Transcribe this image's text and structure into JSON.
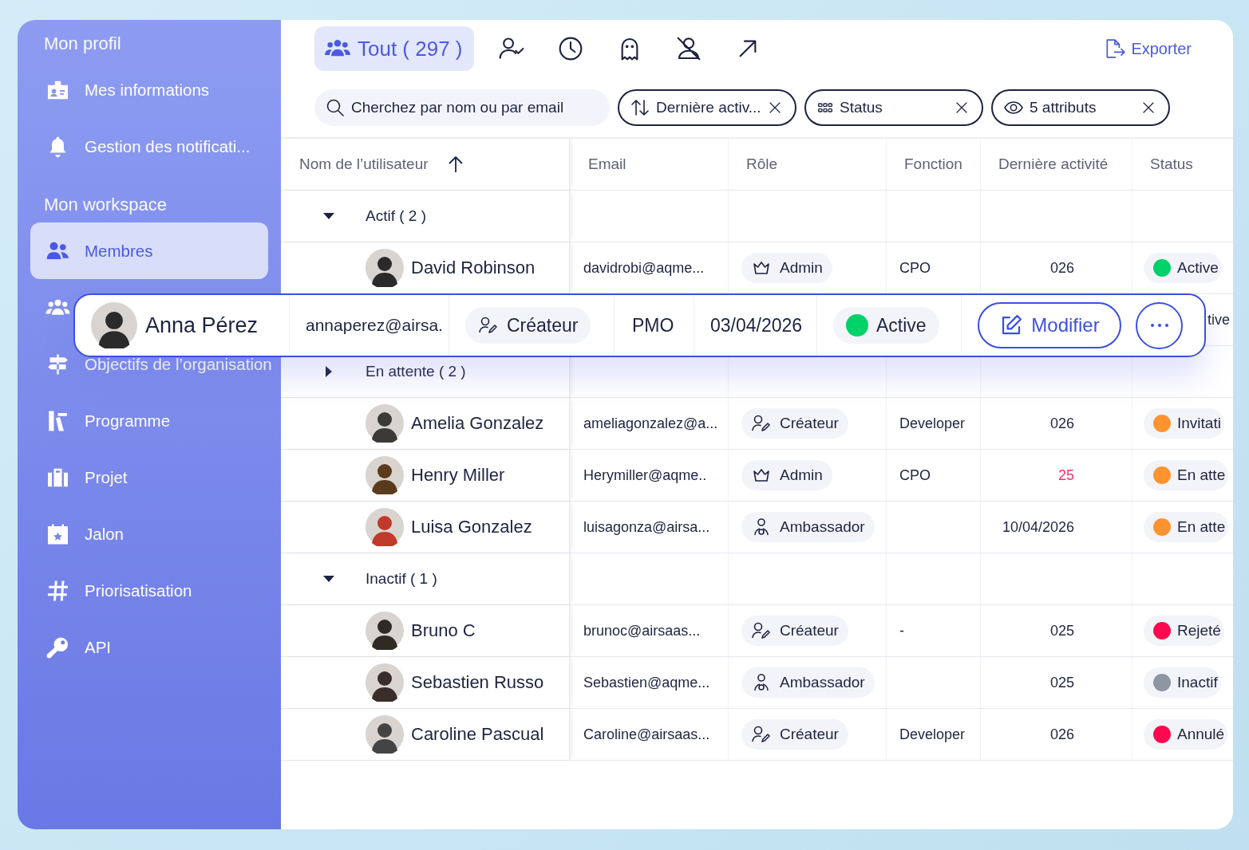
{
  "sidebar": {
    "sections": [
      {
        "title": "Mon profil",
        "items": [
          {
            "label": "Mes informations",
            "selected": false
          },
          {
            "label": "Gestion des notificati...",
            "selected": false
          }
        ]
      },
      {
        "title": "Mon workspace",
        "items": [
          {
            "label": "Membres",
            "selected": true
          },
          {
            "selected": false
          },
          {
            "label": "Objectifs de l’organisation",
            "selected": false
          },
          {
            "label": "Programme",
            "selected": false
          },
          {
            "label": "Projet",
            "selected": false
          },
          {
            "label": "Jalon",
            "selected": false
          },
          {
            "label": "Priorisatisation",
            "selected": false
          },
          {
            "label": "API",
            "selected": false
          }
        ]
      }
    ]
  },
  "tabs": [
    {
      "kind": "all",
      "label": "Tout ( 297 )",
      "selected": true
    },
    {
      "kind": "validated",
      "selected": false
    },
    {
      "kind": "pending",
      "selected": false
    },
    {
      "kind": "ghost",
      "selected": false
    },
    {
      "kind": "disabled",
      "selected": false
    },
    {
      "kind": "external",
      "selected": false
    }
  ],
  "export": {
    "label": "Exporter"
  },
  "search": {
    "placeholder": "Cherchez par nom ou par email"
  },
  "chips": [
    {
      "kind": "sort",
      "label": "Dernière activ..."
    },
    {
      "kind": "grid",
      "label": "Status"
    },
    {
      "kind": "eye",
      "label": "5 attributs"
    }
  ],
  "table": {
    "columns": [
      {
        "label": "Nom de l’utilisateur",
        "sorted": true
      },
      {
        "label": "Email",
        "sorted": false
      },
      {
        "label": "Rôle",
        "sorted": false
      },
      {
        "label": "Fonction",
        "sorted": false
      },
      {
        "label": "Dernière activité",
        "sorted": false
      },
      {
        "label": "Status",
        "sorted": false
      }
    ],
    "groups": [
      {
        "label": "Actif ( 2 )",
        "expanded": true,
        "rows": [
          {
            "kind": "member",
            "name": "David Robinson",
            "email": "davidrobi@aqme...",
            "role": {
              "kind": "admin",
              "label": "Admin"
            },
            "function": "CPO",
            "last_activity": "026",
            "overdue": false,
            "status": {
              "label": "Active",
              "color": "#00d26a"
            }
          },
          {
            "kind": "covered",
            "status": {
              "label": "tive"
            }
          }
        ]
      },
      {
        "label": "En attente ( 2 )",
        "expanded": false,
        "rows": [
          {
            "kind": "member",
            "name": "Amelia Gonzalez",
            "email": "ameliagonzalez@a...",
            "role": {
              "kind": "creator",
              "label": "Créateur"
            },
            "function": "Developer",
            "last_activity": "026",
            "overdue": false,
            "status": {
              "label": "Invitati",
              "color": "#ff9330"
            }
          },
          {
            "kind": "member",
            "name": "Henry Miller",
            "email": "Herymiller@aqme..",
            "role": {
              "kind": "admin",
              "label": "Admin"
            },
            "function": "CPO",
            "last_activity": "25",
            "overdue": true,
            "status": {
              "label": "En atte",
              "color": "#ff9330"
            }
          },
          {
            "kind": "member",
            "name": "Luisa Gonzalez",
            "email": "luisagonza@airsa...",
            "role": {
              "kind": "ambassador",
              "label": "Ambassador"
            },
            "last_activity": "10/04/2026",
            "overdue": false,
            "status": {
              "label": "En atte",
              "color": "#ff9330"
            }
          }
        ]
      },
      {
        "label": "Inactif ( 1 )",
        "expanded": true,
        "rows": [
          {
            "kind": "member",
            "name": "Bruno C",
            "email": "brunoc@airsaas...",
            "role": {
              "kind": "creator",
              "label": "Créateur"
            },
            "function": "-",
            "last_activity": "025",
            "overdue": false,
            "status": {
              "label": "Rejeté",
              "color": "#ff0a4e"
            }
          },
          {
            "kind": "member",
            "name": "Sebastien Russo",
            "email": "Sebastien@aqme...",
            "role": {
              "kind": "ambassador",
              "label": "Ambassador"
            },
            "last_activity": "025",
            "overdue": false,
            "status": {
              "label": "Inactif",
              "color": "#8f96a3"
            }
          },
          {
            "kind": "member",
            "name": "Caroline Pascual",
            "email": "Caroline@airsaas...",
            "role": {
              "kind": "creator",
              "label": "Créateur"
            },
            "function": "Developer",
            "last_activity": "026",
            "overdue": false,
            "status": {
              "label": "Annulé",
              "color": "#ff0a4e"
            }
          }
        ]
      }
    ]
  },
  "focused_row": {
    "name": "Anna Pérez",
    "email": "annaperez@airsa.",
    "role": {
      "kind": "creator",
      "label": "Créateur"
    },
    "function": "PMO",
    "last_activity": "03/04/2026",
    "status": {
      "label": "Active",
      "color": "#00d26a"
    },
    "actions": [
      {
        "kind": "edit",
        "label": "Modifier"
      },
      {
        "kind": "more"
      }
    ]
  }
}
